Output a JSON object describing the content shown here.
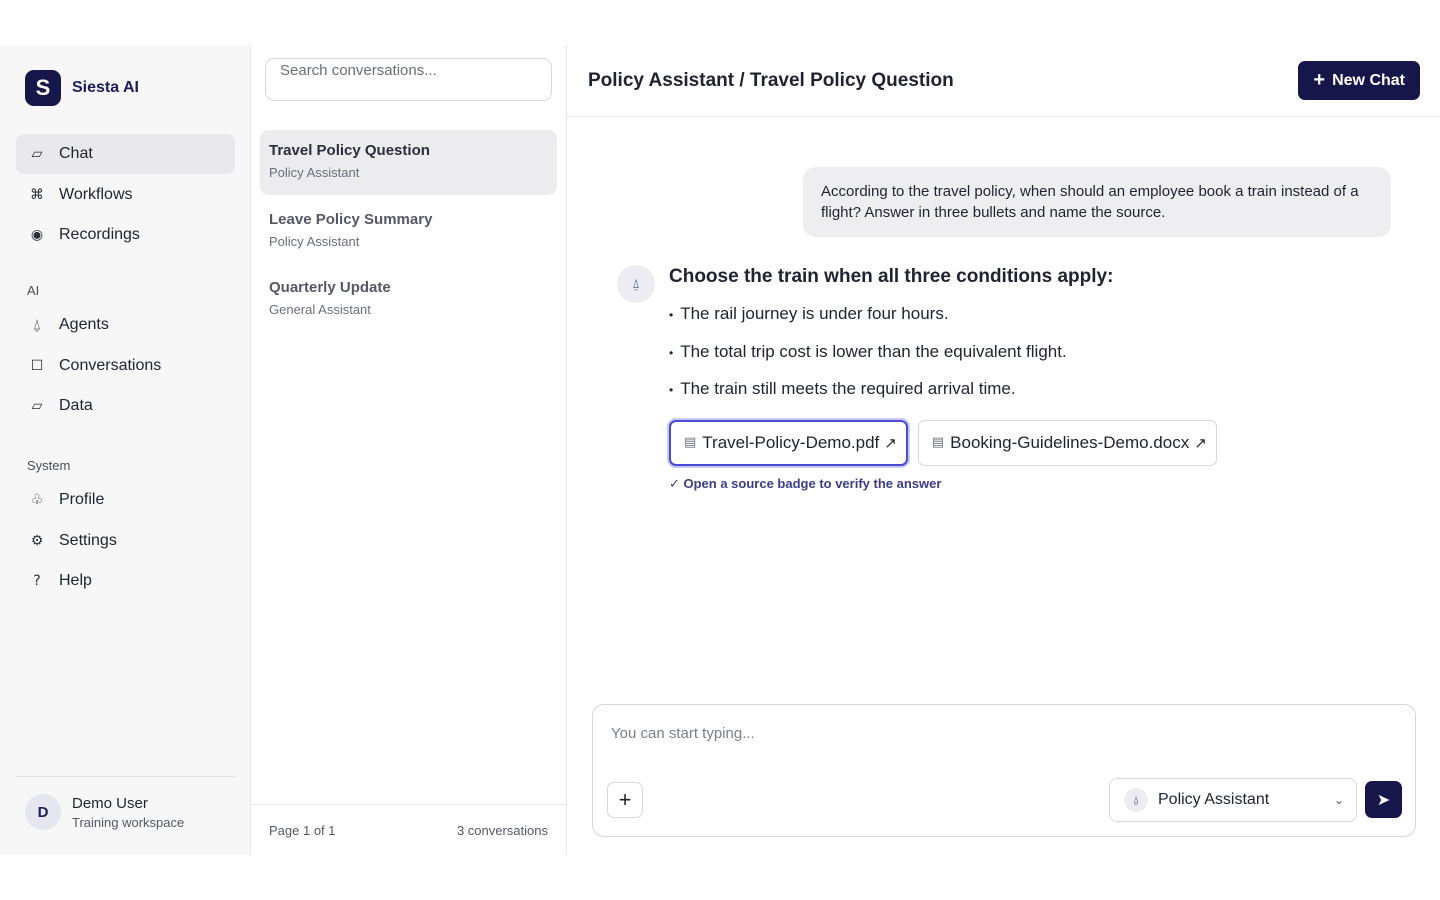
{
  "brand": {
    "logo_letter": "S",
    "name": "Siesta AI"
  },
  "nav": {
    "main": [
      {
        "label": "Chat",
        "icon": "chat-icon",
        "glyph": "▱",
        "active": true
      },
      {
        "label": "Workflows",
        "icon": "workflow-icon",
        "glyph": "⌘"
      },
      {
        "label": "Recordings",
        "icon": "record-icon",
        "glyph": "◉"
      }
    ],
    "ai_section": "AI",
    "ai": [
      {
        "label": "Agents",
        "icon": "agent-icon",
        "glyph": "⍙"
      },
      {
        "label": "Conversations",
        "icon": "conversation-icon",
        "glyph": "☐"
      },
      {
        "label": "Data",
        "icon": "data-icon",
        "glyph": "▱"
      }
    ],
    "system_section": "System",
    "system": [
      {
        "label": "Profile",
        "icon": "profile-icon",
        "glyph": "♧"
      },
      {
        "label": "Settings",
        "icon": "gear-icon",
        "glyph": "⚙"
      },
      {
        "label": "Help",
        "icon": "help-icon",
        "glyph": "?"
      }
    ]
  },
  "user": {
    "initial": "D",
    "name": "Demo User",
    "workspace": "Training workspace"
  },
  "search": {
    "placeholder": "Search conversations..."
  },
  "conversations": [
    {
      "title": "Travel Policy Question",
      "agent": "Policy Assistant",
      "active": true
    },
    {
      "title": "Leave Policy Summary",
      "agent": "Policy Assistant"
    },
    {
      "title": "Quarterly Update",
      "agent": "General Assistant"
    }
  ],
  "pagination": {
    "page": "Page 1 of 1",
    "count": "3 conversations"
  },
  "header": {
    "title": "Policy Assistant / Travel Policy Question",
    "new_chat": "New Chat",
    "new_chat_glyph": "+"
  },
  "user_message": "According to the travel policy, when should an employee book a train instead of a flight? Answer in three bullets and name the source.",
  "assistant": {
    "avatar_glyph": "⍙",
    "heading": "Choose the train when all three conditions apply:",
    "bullets": [
      "The rail journey is under four hours.",
      "The total trip cost is lower than the equivalent flight.",
      "The train still meets the required arrival time."
    ],
    "sources": [
      {
        "name": "Travel-Policy-Demo.pdf",
        "selected": true
      },
      {
        "name": "Booking-Guidelines-Demo.docx"
      }
    ],
    "verify_note": "✓ Open a source badge to verify the answer"
  },
  "composer": {
    "placeholder": "You can start typing...",
    "attach_glyph": "+",
    "agent": "Policy Assistant",
    "send_glyph": "➤"
  }
}
